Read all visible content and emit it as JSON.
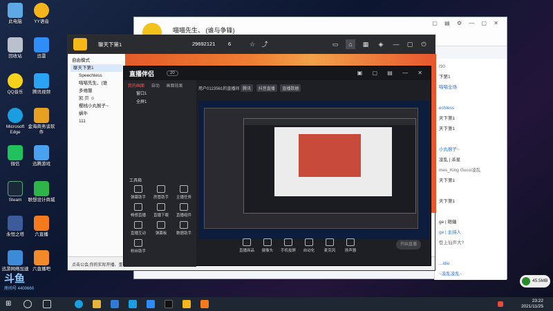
{
  "desktop": {
    "icons": [
      {
        "label": "此电脑",
        "color": "#5fa8e6"
      },
      {
        "label": "YY语音",
        "color": "#f4b41c"
      },
      {
        "label": "回收站",
        "color": "#b9c2cc"
      },
      {
        "label": "迅雷",
        "color": "#2f8dfa"
      },
      {
        "label": "QQ音乐",
        "color": "#f7d21a"
      },
      {
        "label": "腾讯视频",
        "color": "#2aa3f4"
      },
      {
        "label": "Microsoft Edge",
        "color": "#1b9de2"
      },
      {
        "label": "金海商务谈软件",
        "color": "#e5a11f"
      },
      {
        "label": "微信",
        "color": "#21c25e"
      },
      {
        "label": "迅腾游戏",
        "color": "#4aa1f0"
      },
      {
        "label": "Steam",
        "color": "#1b2838"
      },
      {
        "label": "联想设计商城",
        "color": "#2fb44a"
      },
      {
        "label": "永恒之塔",
        "color": "#3d5a9a"
      },
      {
        "label": "六直播",
        "color": "#f57a1e"
      },
      {
        "label": "迅游网络加速",
        "color": "#3d8bd8"
      },
      {
        "label": "六直播吧",
        "color": "#f28a2a"
      }
    ]
  },
  "qq_window": {
    "name": "喵喵先生、 (谁与争锋)",
    "side_lines": [
      {
        "text": "/30",
        "style": "gray"
      },
      {
        "text": "下第1"
      },
      {
        "text": "喵喵全场",
        "style": "blue"
      },
      {
        "text": "",
        "style": "gray"
      },
      {
        "text": "echless",
        "style": "blue"
      },
      {
        "text": "天下第1"
      },
      {
        "text": "天下第1"
      },
      {
        "text": "",
        "style": "gray"
      },
      {
        "text": "小丸猴子~",
        "style": "blue"
      },
      {
        "text": "凌乱 | 杀星"
      },
      {
        "text": "mes_King Gucci凌乱",
        "style": "gray"
      },
      {
        "text": "天下第1"
      },
      {
        "text": "",
        "style": "gray"
      },
      {
        "text": "天下第1"
      },
      {
        "text": "",
        "style": "gray"
      },
      {
        "text": "ge | 砸蛐"
      },
      {
        "text": "ge | 主持人",
        "style": "blue"
      },
      {
        "text": "登上仙声大?",
        "style": "gray"
      },
      {
        "text": "",
        "style": "gray"
      },
      {
        "text": "...idio",
        "style": "blue"
      },
      {
        "text": "~凌乱凌乱~",
        "style": "blue"
      }
    ]
  },
  "yy_window": {
    "channel_name": "聊天下第1",
    "channel_id": "29692121",
    "online_count": "6",
    "tree": [
      {
        "text": "自由模式"
      },
      {
        "text": "聊天下第1",
        "selected": true
      },
      {
        "text": "Speechless"
      },
      {
        "text": "喵喵先生、(谁"
      },
      {
        "text": "多维服"
      },
      {
        "text": "凯 贝 ☺"
      },
      {
        "text": "樱桃小丸猴子~"
      },
      {
        "text": "蜗牛"
      },
      {
        "text": "111"
      }
    ],
    "bottom_text": "点击公会,你的实际开播、重播和短视 上午一号 你好"
  },
  "live_window": {
    "brand": "直播伴侣",
    "version": "20",
    "tabs": [
      "我的画面",
      "自动",
      "画面效果"
    ],
    "scenes": [
      "窗口1",
      "全屏1"
    ],
    "tools_header": "工具箱",
    "tools": [
      "弹幕助手",
      "房管助手",
      "主播任务",
      "畅想直播",
      "直播下载",
      "直播组件",
      "直播互动",
      "弹幕板",
      "数据助手",
      "粉丝助手"
    ],
    "info_line": "用户0123561的直播间",
    "tags": [
      "腾讯",
      "抖音直播",
      "直播数据"
    ],
    "bottom_tools": [
      "直播商品",
      "摄像头",
      "手机投屏",
      "自动化",
      "麦克风",
      "扬声器"
    ],
    "go_live_label": "开始直播"
  },
  "taskbar": {
    "time": "23:22",
    "date": "2021/11/25"
  },
  "speed_indicator": "45.5MB",
  "watermark": {
    "title": "斗鱼",
    "sub": "房间号 4400660"
  }
}
